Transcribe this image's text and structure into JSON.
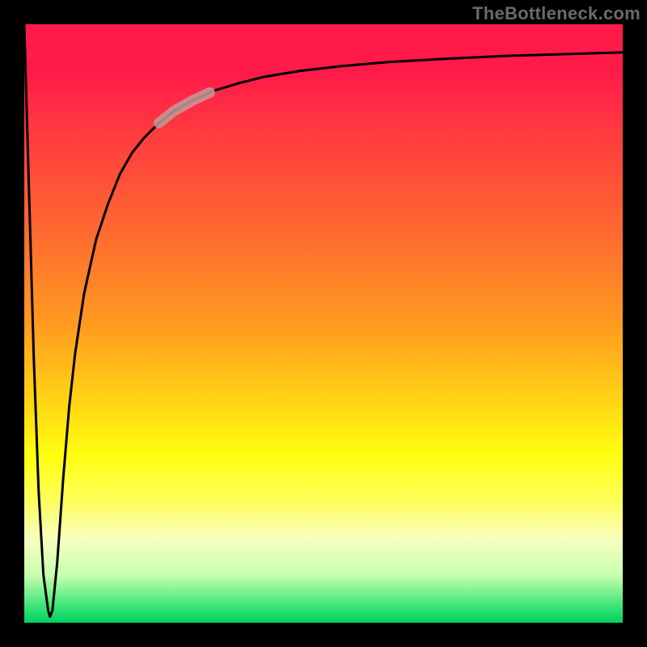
{
  "watermark": {
    "text": "TheBottleneck.com"
  },
  "chart_data": {
    "type": "line",
    "title": "",
    "xlabel": "",
    "ylabel": "",
    "xlim": [
      0,
      100
    ],
    "ylim": [
      0,
      100
    ],
    "grid": false,
    "legend": false,
    "series": [
      {
        "name": "bottleneck-curve",
        "x": [
          0.0,
          0.8,
          1.6,
          2.4,
          3.2,
          4.0,
          4.3,
          4.7,
          5.5,
          6.5,
          7.5,
          8.5,
          10.0,
          12.0,
          14.0,
          16.0,
          18.0,
          20.0,
          22.5,
          25.0,
          28.0,
          32.0,
          36.0,
          40.0,
          46.0,
          53.0,
          61.0,
          70.0,
          80.0,
          90.0,
          100.0
        ],
        "values": [
          100.0,
          72.0,
          44.0,
          22.0,
          8.0,
          2.0,
          1.0,
          2.0,
          10.0,
          24.0,
          36.0,
          45.0,
          55.0,
          64.0,
          70.0,
          75.0,
          78.5,
          81.0,
          83.5,
          85.5,
          87.2,
          89.0,
          90.2,
          91.2,
          92.2,
          93.0,
          93.7,
          94.2,
          94.7,
          95.0,
          95.3
        ]
      }
    ],
    "highlight": {
      "name": "highlighted-segment",
      "x": [
        22.5,
        25.0,
        28.0,
        31.0
      ],
      "values": [
        83.5,
        85.5,
        87.2,
        88.6
      ]
    },
    "background_gradient": {
      "stops": [
        {
          "pos": 0.0,
          "color": "#ff1a4a"
        },
        {
          "pos": 0.35,
          "color": "#ff6a30"
        },
        {
          "pos": 0.62,
          "color": "#ffd015"
        },
        {
          "pos": 0.78,
          "color": "#ffff30"
        },
        {
          "pos": 0.92,
          "color": "#c8ffb0"
        },
        {
          "pos": 1.0,
          "color": "#00d060"
        }
      ]
    }
  }
}
